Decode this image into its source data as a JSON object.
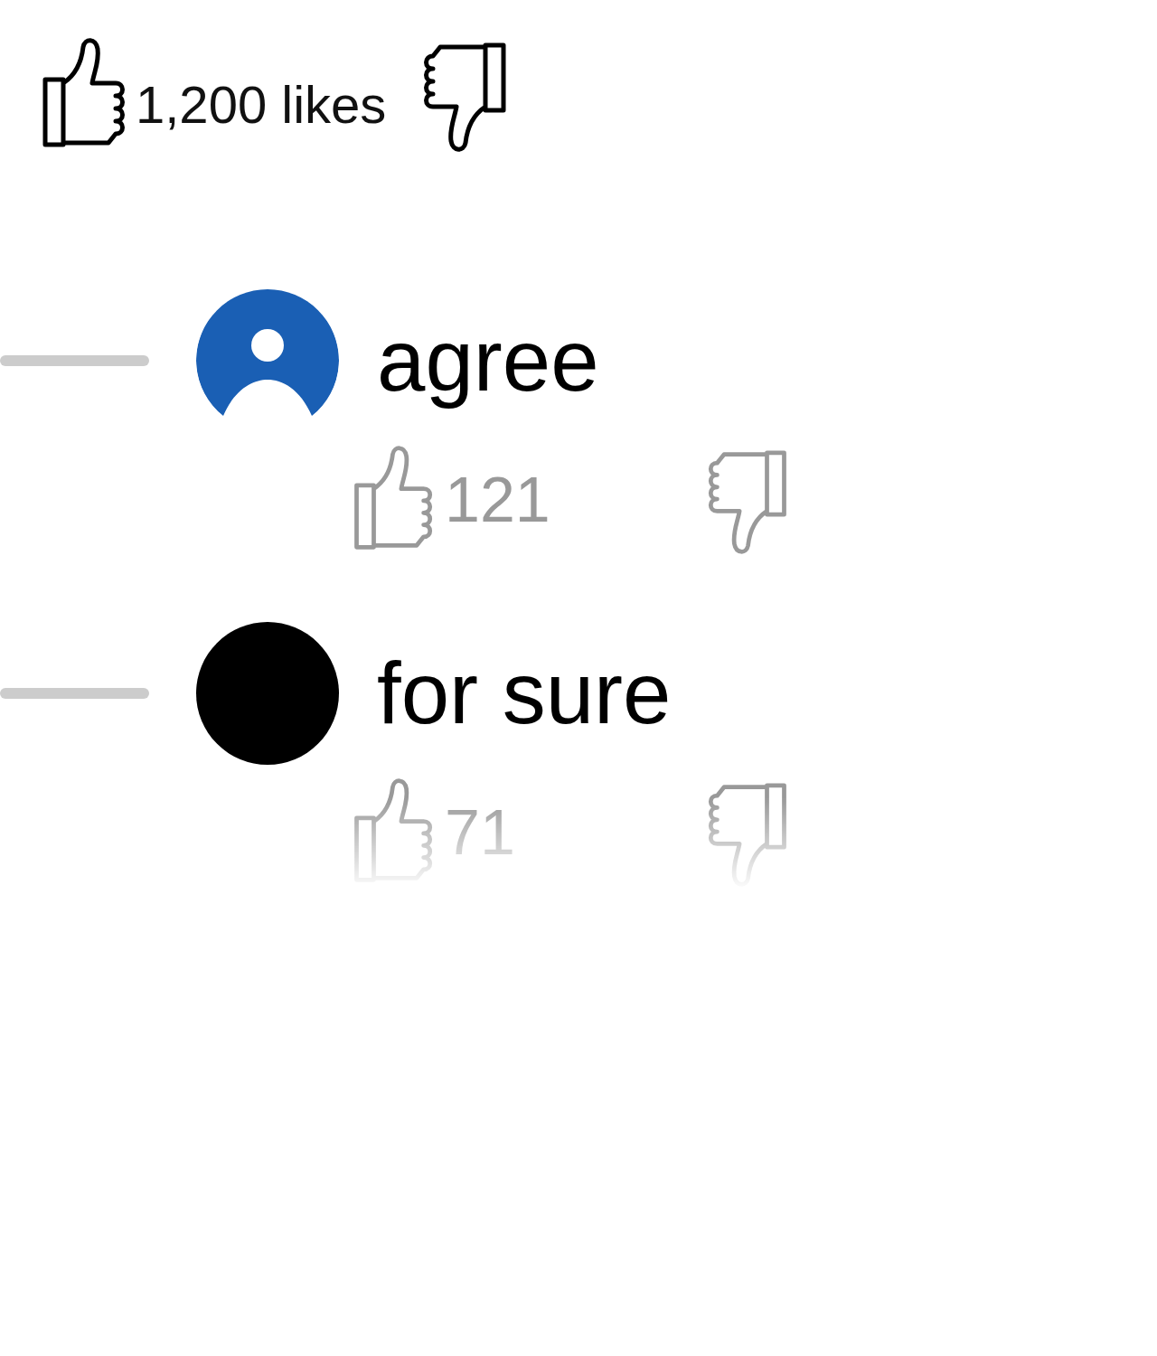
{
  "post": {
    "likes": "1,200 likes"
  },
  "replies": [
    {
      "avatar": {
        "kind": "person",
        "color": "#1a5fb4"
      },
      "text": "agree",
      "likes": "121",
      "faded": false
    },
    {
      "avatar": {
        "kind": "plain",
        "color": "#000000"
      },
      "text": "for sure",
      "likes": "71",
      "faded": true
    }
  ]
}
